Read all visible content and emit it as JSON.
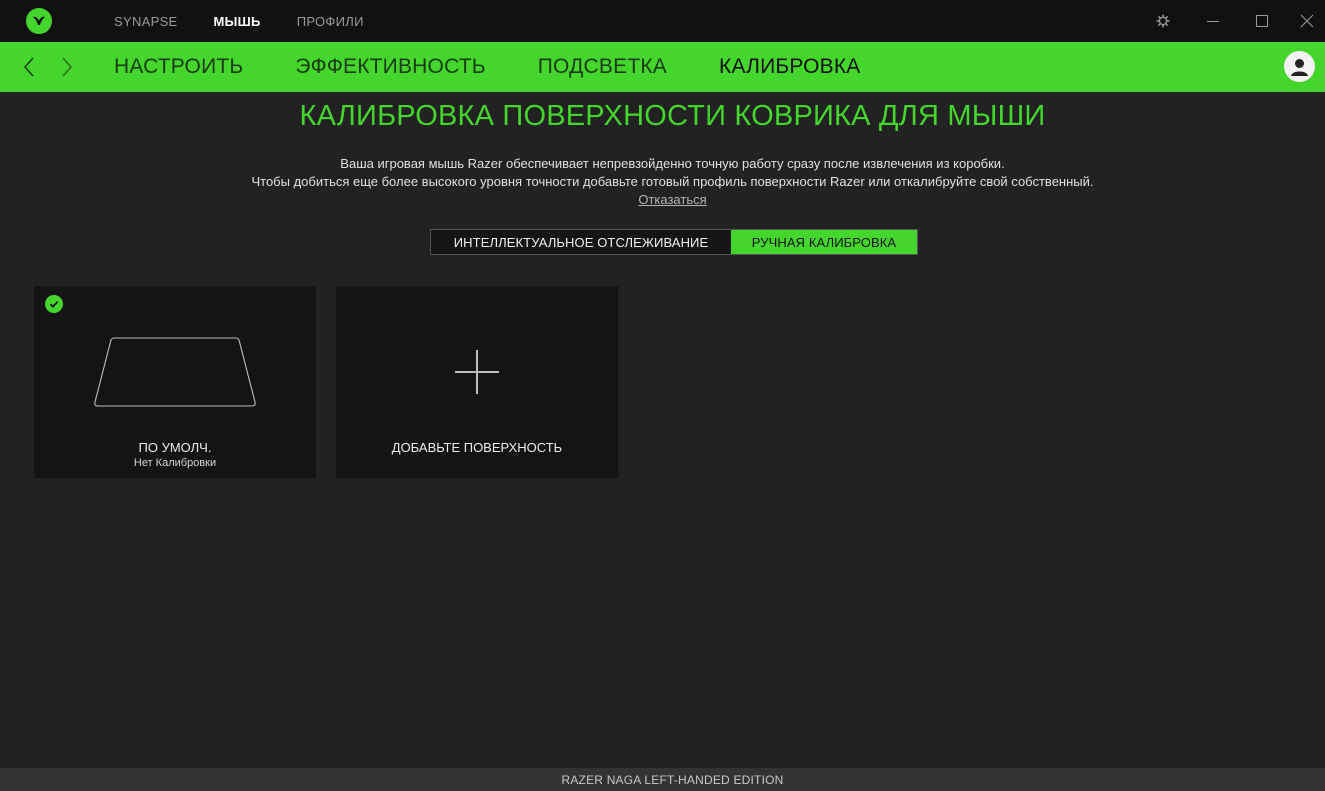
{
  "topnav": {
    "items": [
      {
        "label": "SYNAPSE",
        "active": false
      },
      {
        "label": "МЫШЬ",
        "active": true
      },
      {
        "label": "ПРОФИЛИ",
        "active": false
      }
    ]
  },
  "subnav": {
    "tabs": [
      {
        "label": "НАСТРОИТЬ",
        "active": false
      },
      {
        "label": "ЭФФЕКТИВНОСТЬ",
        "active": false
      },
      {
        "label": "ПОДСВЕТКА",
        "active": false
      },
      {
        "label": "КАЛИБРОВКА",
        "active": true
      }
    ]
  },
  "main": {
    "title": "КАЛИБРОВКА ПОВЕРХНОСТИ КОВРИКА ДЛЯ МЫШИ",
    "desc_line1": "Ваша игровая мышь Razer обеспечивает непревзойденно точную работу сразу после извлечения из коробки.",
    "desc_line2": "Чтобы добиться еще более высокого уровня точности добавьте готовый профиль поверхности Razer или откалибруйте свой собственный.",
    "opt_out": "Отказаться",
    "toggle": {
      "option1": "ИНТЕЛЛЕКТУАЛЬНОЕ ОТСЛЕЖИВАНИЕ",
      "option2": "РУЧНАЯ КАЛИБРОВКА",
      "selected": "option2"
    },
    "cards": [
      {
        "name": "ПО УМОЛЧ.",
        "sub": "Нет Калибровки",
        "selected": true
      },
      {
        "name": "ДОБАВЬТЕ ПОВЕРХНОСТЬ"
      }
    ]
  },
  "status": {
    "device": "RAZER NAGA LEFT-HANDED EDITION"
  },
  "icons": {
    "logo": "razer-logo-icon",
    "settings": "gear-icon",
    "minimize": "minimize-icon",
    "maximize": "maximize-icon",
    "close": "close-icon",
    "back": "chevron-left-icon",
    "forward": "chevron-right-icon",
    "avatar": "user-avatar-icon",
    "check": "check-icon",
    "add": "plus-icon",
    "mousepad": "mousepad-icon"
  },
  "colors": {
    "accent": "#44d62c",
    "titlebar": "#111111",
    "background": "#222222",
    "card": "#141414"
  }
}
